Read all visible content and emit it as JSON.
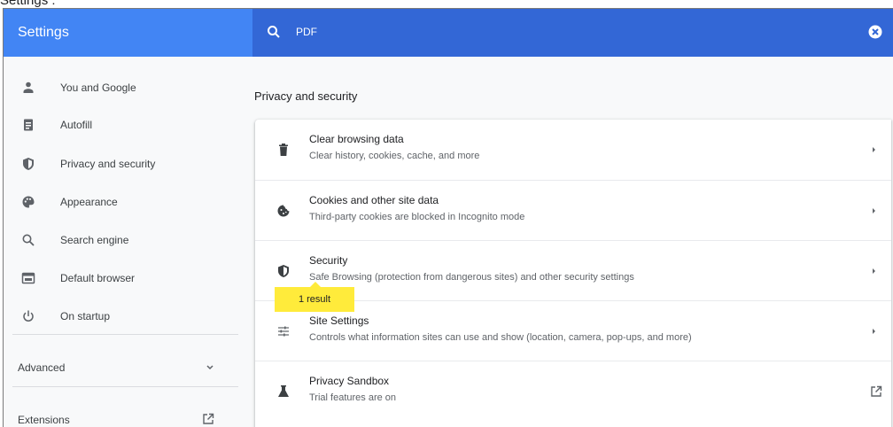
{
  "caption": "Settings :",
  "header": {
    "title": "Settings",
    "search_value": "PDF"
  },
  "sidebar": {
    "items": [
      {
        "label": "You and Google",
        "icon": "person-icon"
      },
      {
        "label": "Autofill",
        "icon": "clipboard-icon"
      },
      {
        "label": "Privacy and security",
        "icon": "shield-icon"
      },
      {
        "label": "Appearance",
        "icon": "palette-icon"
      },
      {
        "label": "Search engine",
        "icon": "search-icon"
      },
      {
        "label": "Default browser",
        "icon": "browser-window-icon"
      },
      {
        "label": "On startup",
        "icon": "power-icon"
      }
    ],
    "advanced_label": "Advanced",
    "extensions_label": "Extensions"
  },
  "main": {
    "section_title": "Privacy and security",
    "rows": [
      {
        "title": "Clear browsing data",
        "subtitle": "Clear history, cookies, cache, and more",
        "icon": "trash-icon"
      },
      {
        "title": "Cookies and other site data",
        "subtitle": "Third-party cookies are blocked in Incognito mode",
        "icon": "cookie-icon"
      },
      {
        "title": "Security",
        "subtitle": "Safe Browsing (protection from dangerous sites) and other security settings",
        "icon": "security-shield-icon"
      },
      {
        "title": "Site Settings",
        "subtitle": "Controls what information sites can use and show (location, camera, pop-ups, and more)",
        "icon": "sliders-icon"
      },
      {
        "title": "Privacy Sandbox",
        "subtitle": "Trial features are on",
        "icon": "flask-icon"
      }
    ],
    "search_bubble": "1 result"
  },
  "colors": {
    "header_left": "#4285f4",
    "header_right": "#3367d6",
    "bubble": "#ffeb3b"
  }
}
